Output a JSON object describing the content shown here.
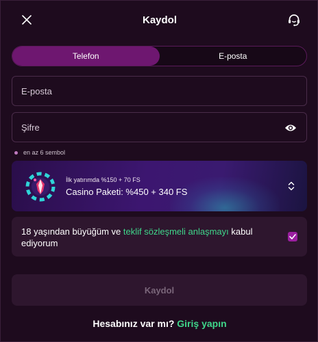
{
  "header": {
    "title": "Kaydol",
    "close_icon": "close-icon",
    "support_icon": "headset-support-icon"
  },
  "tabs": [
    {
      "label": "Telefon",
      "active": true
    },
    {
      "label": "E-posta",
      "active": false
    }
  ],
  "form": {
    "email_placeholder": "E-posta",
    "email_value": "",
    "password_placeholder": "Şifre",
    "password_value": "",
    "password_hint": "en az 6 sembol"
  },
  "promo": {
    "line1": "İlk yatırımda %150 + 70 FS",
    "line2": "Casino Paketi: %450 + 340 FS"
  },
  "consent": {
    "text_before": "18 yaşından büyüğüm ve ",
    "link_text": "teklif sözleşmeli anlaşmayı",
    "text_after": " kabul ediyorum",
    "checked": true
  },
  "submit_label": "Kaydol",
  "footer": {
    "question": "Hesabınız var mı? ",
    "link": "Giriş yapın"
  },
  "colors": {
    "background": "#1e0b1e",
    "accent": "#6e1770",
    "link": "#3fd68a",
    "checkbox": "#9b1fa0"
  }
}
